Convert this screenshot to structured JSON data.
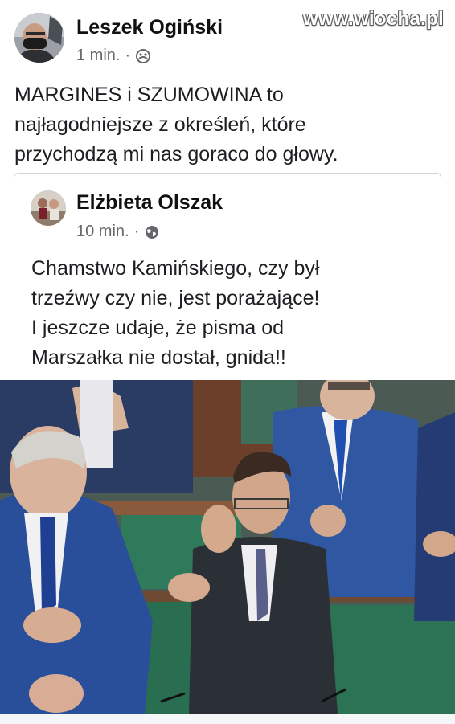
{
  "watermark": "www.wiocha.pl",
  "post": {
    "author": "Leszek Ogiński",
    "time": "1 min.",
    "separator": "·",
    "audience_icon": "friends-icon",
    "lines": [
      "MARGINES i SZUMOWINA to",
      "najłagodniejsze z określeń, które",
      "przychodzą mi nas goraco do głowy."
    ]
  },
  "shared_post": {
    "author": "Elżbieta Olszak",
    "time": "10 min.",
    "separator": "·",
    "audience_icon": "globe-icon",
    "lines": [
      "Chamstwo Kamińskiego, czy był",
      "trzeźwy czy nie, jest porażające!",
      "I jeszcze udaje, że pisma od",
      "Marszałka nie dostał, gnida!!"
    ]
  },
  "colors": {
    "text": "#1c1e21",
    "meta": "#65676b",
    "border": "#d0d3d8"
  }
}
